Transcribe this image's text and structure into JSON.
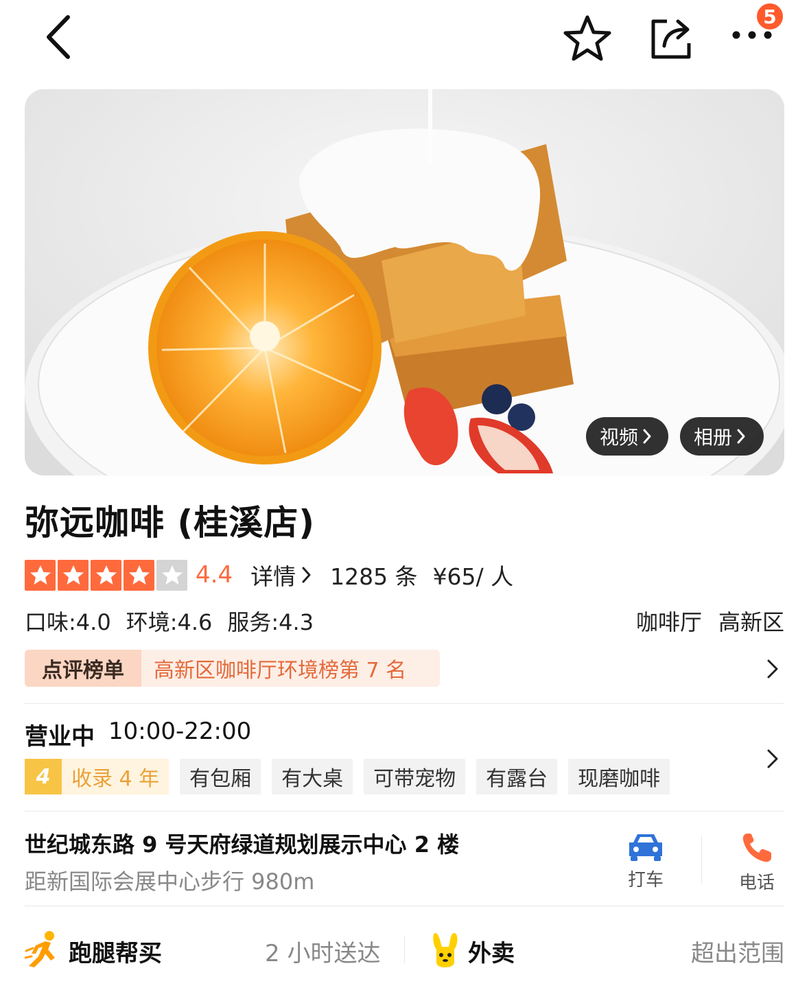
{
  "top_bar": {
    "notification_count": "5",
    "icons": [
      "back-arrow-icon",
      "star-outline-icon",
      "share-icon",
      "more-dots-icon"
    ]
  },
  "hero": {
    "video_label": "视频",
    "album_label": "相册"
  },
  "shop": {
    "name": "弥远咖啡 (桂溪店)",
    "stars": 4,
    "stars_max": 5,
    "score": "4.4",
    "detail_label": "详情",
    "review_count": "1285 条",
    "price": "¥65/ 人",
    "sub_scores": [
      "口味:4.0",
      "环境:4.6",
      "服务:4.3"
    ],
    "category": "咖啡厅",
    "district": "高新区"
  },
  "ranking": {
    "badge": "点评榜单",
    "text": "高新区咖啡厅环境榜第 7 名"
  },
  "hours": {
    "status": "营业中",
    "time": "10:00-22:00"
  },
  "tags": {
    "year_number": "4",
    "year_text": "收录 4 年",
    "features": [
      "有包厢",
      "有大桌",
      "可带宠物",
      "有露台",
      "现磨咖啡"
    ]
  },
  "location": {
    "address": "世纪城东路 9 号天府绿道规划展示中心 2 楼",
    "distance": "距新国际会展中心步行 980m",
    "taxi_label": "打车",
    "phone_label": "电话"
  },
  "services": {
    "errand_label": "跑腿帮买",
    "errand_time": "2 小时送达",
    "delivery_label": "外卖",
    "delivery_status": "超出范围"
  },
  "colors": {
    "accent_orange": "#ff6a3d",
    "badge_red": "#ff5a2c",
    "taxi_blue": "#2f73d8",
    "phone_orange": "#ff6a3d",
    "year_gold": "#f7c446"
  }
}
